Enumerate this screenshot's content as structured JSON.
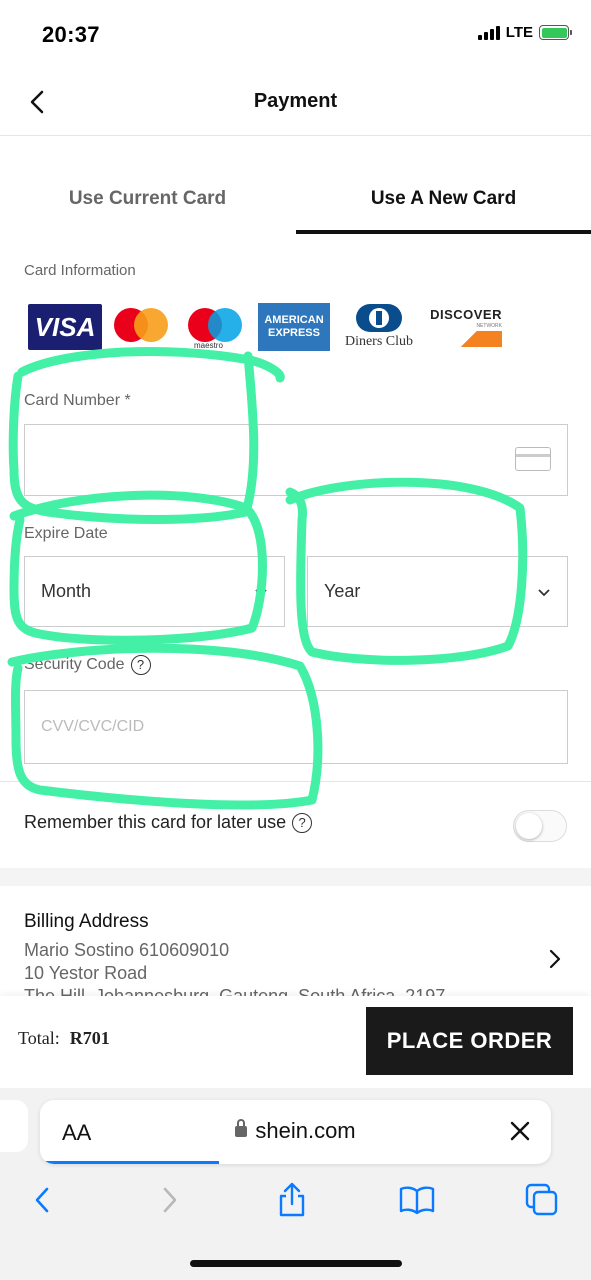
{
  "status_bar": {
    "time": "20:37",
    "network": "LTE"
  },
  "header": {
    "title": "Payment"
  },
  "tabs": [
    {
      "label": "Use Current Card",
      "active": false
    },
    {
      "label": "Use A New Card",
      "active": true
    }
  ],
  "card_info": {
    "label": "Card Information",
    "logos": {
      "visa": "VISA",
      "maestro": "maestro",
      "amex_line1": "AMERICAN",
      "amex_line2": "EXPRESS",
      "diners": "Diners Club",
      "discover": "DISCOVER",
      "discover_sub": "NETWORK"
    }
  },
  "form": {
    "card_number": {
      "label": "Card Number",
      "required_mark": "*",
      "value": ""
    },
    "expire_date": {
      "label": "Expire Date",
      "month": "Month",
      "year": "Year"
    },
    "security_code": {
      "label": "Security Code",
      "placeholder": "CVV/CVC/CID"
    },
    "remember": {
      "label": "Remember this card for later use",
      "enabled": false
    }
  },
  "billing": {
    "title": "Billing Address",
    "lines": [
      "Mario Sostino 610609010",
      "10 Yestor Road",
      "The Hill, Johannesburg, Gauteng, South Africa, 2197"
    ]
  },
  "order": {
    "total_label": "Total:",
    "total_value": "R701",
    "button": "PLACE ORDER"
  },
  "browser": {
    "text_size": "AA",
    "url": "shein.com",
    "load_progress": 0.35
  },
  "colors": {
    "accent": "#111111",
    "highlighter": "#43f0a6",
    "link_blue": "#0a7aff"
  },
  "icons": [
    "back-chevron-icon",
    "card-icon",
    "chevron-down-icon",
    "help-icon",
    "chevron-right-icon",
    "lock-icon",
    "close-icon",
    "back-icon",
    "forward-icon",
    "share-icon",
    "bookmarks-icon",
    "tabs-icon"
  ]
}
